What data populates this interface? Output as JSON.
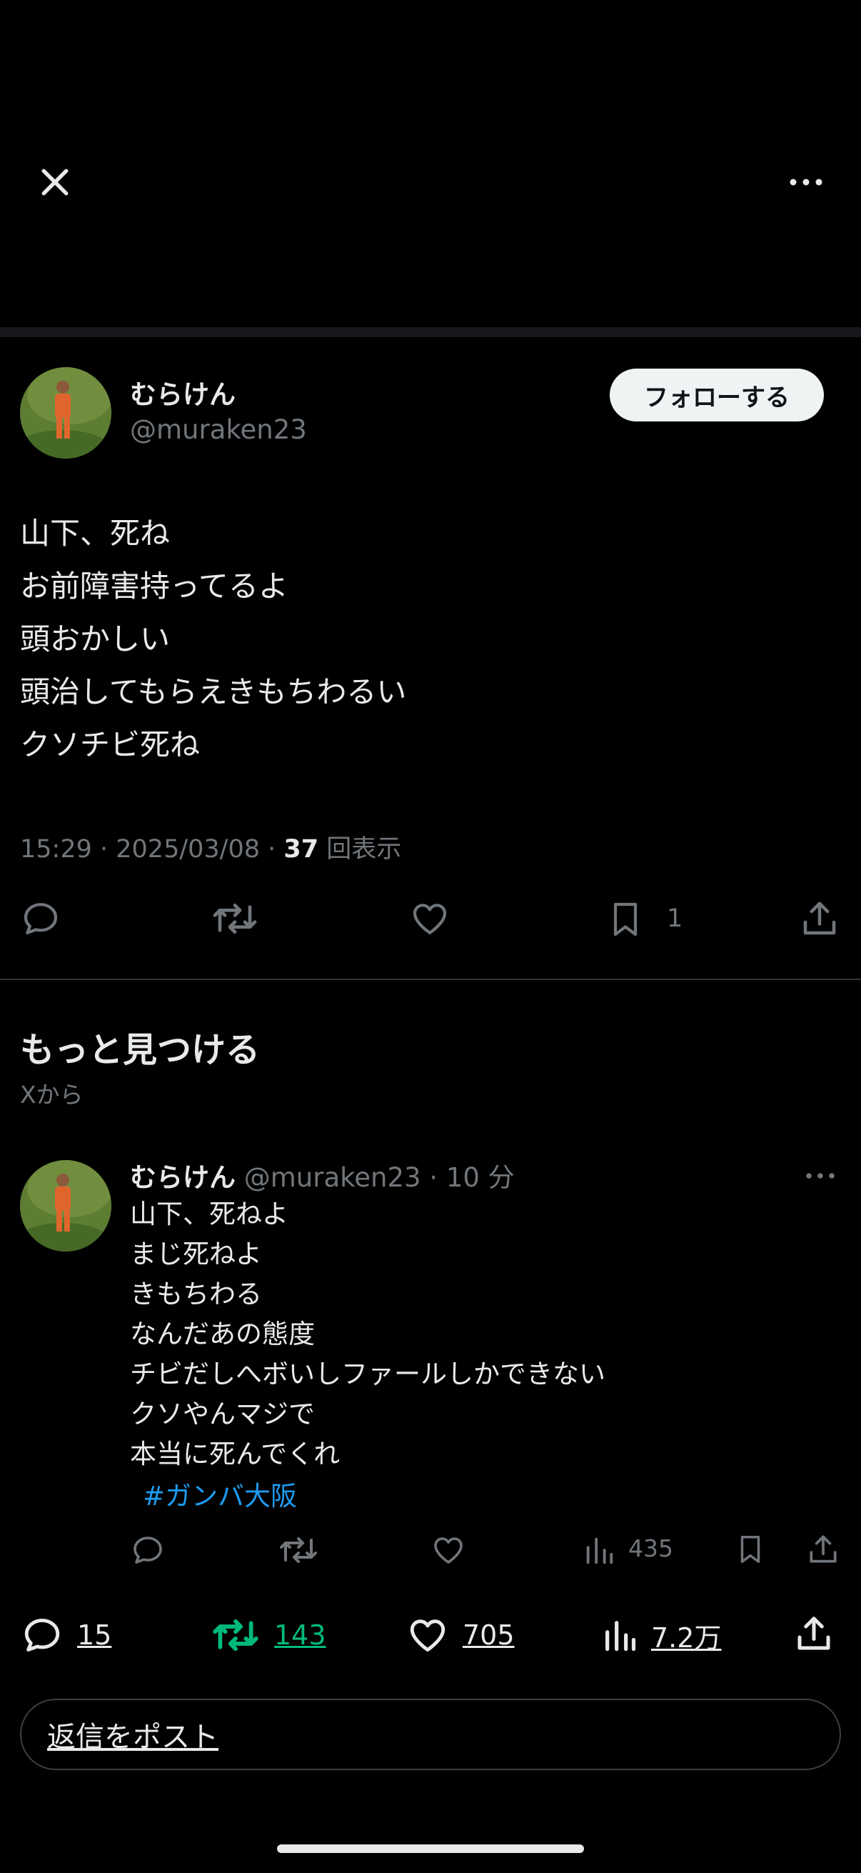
{
  "header": {
    "close_icon": "close-icon",
    "more_icon": "more-horizontal-icon"
  },
  "main_tweet": {
    "display_name": "むらけん",
    "handle": "@muraken23",
    "follow_label": "フォローする",
    "lines": [
      "山下、死ね",
      "お前障害持ってるよ",
      "頭おかしい",
      "頭治してもらえきもちわるい",
      "クソチビ死ね"
    ],
    "time": "15:29",
    "date": "2025/03/08",
    "views_count": "37",
    "views_label": "回表示",
    "bookmark_count": "1"
  },
  "discover": {
    "title": "もっと見つける",
    "subtitle": "Xから"
  },
  "second_tweet": {
    "display_name": "むらけん",
    "handle": "@muraken23",
    "age": "10 分",
    "lines": [
      "山下、死ねよ",
      "まじ死ねよ",
      "きもちわる",
      "なんだあの態度",
      "チビだしへボいしファールしかできない",
      "クソやんマジで",
      "本当に死んでくれ"
    ],
    "hashtag": "#ガンバ大阪",
    "views": "435"
  },
  "stats_bar": {
    "replies": "15",
    "reposts": "143",
    "likes": "705",
    "views": "7.2万"
  },
  "reply_box": {
    "placeholder": "返信をポスト"
  },
  "colors": {
    "background": "#000000",
    "text": "#e7e9ea",
    "muted": "#71767b",
    "accent": "#1d9bf0",
    "repost_green": "#00ba7c",
    "divider": "#2f3336"
  }
}
